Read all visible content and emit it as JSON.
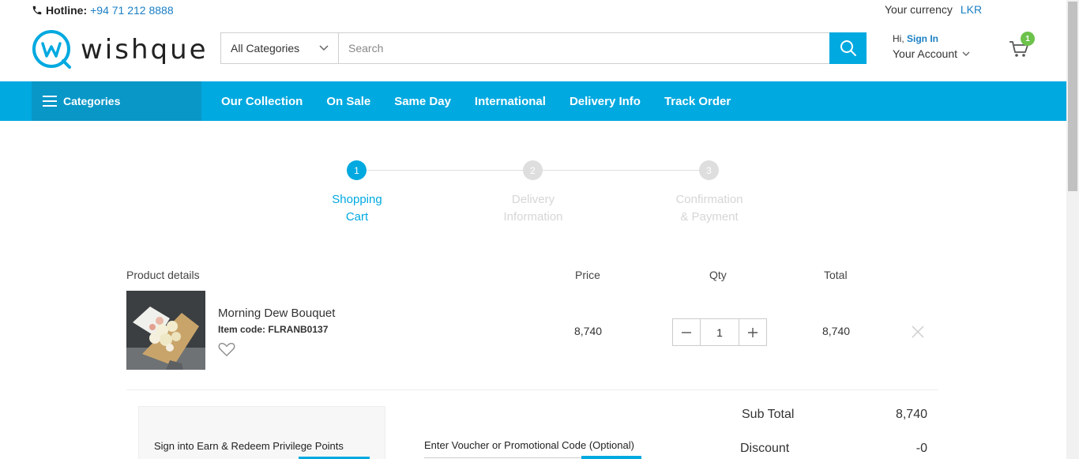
{
  "topbar": {
    "hotline_label": "Hotline:",
    "hotline_number": "+94 71 212 8888",
    "currency_label": "Your currency",
    "currency_code": "LKR"
  },
  "brand": {
    "name": "wishque",
    "color": "#00a9e0"
  },
  "search": {
    "category": "All Categories",
    "placeholder": "Search",
    "icon": "search-icon"
  },
  "account": {
    "greeting": "Hi,",
    "sign_in": "Sign In",
    "your_account": "Your Account",
    "cart_count": "1"
  },
  "nav": {
    "categories_label": "Categories",
    "links": [
      "Our Collection",
      "On Sale",
      "Same Day",
      "International",
      "Delivery Info",
      "Track Order"
    ]
  },
  "steps": [
    {
      "num": "1",
      "line1": "Shopping",
      "line2": "Cart",
      "active": true
    },
    {
      "num": "2",
      "line1": "Delivery",
      "line2": "Information",
      "active": false
    },
    {
      "num": "3",
      "line1": "Confirmation",
      "line2": "& Payment",
      "active": false
    }
  ],
  "cart_table": {
    "headers": {
      "product": "Product details",
      "price": "Price",
      "qty": "Qty",
      "total": "Total"
    },
    "items": [
      {
        "name": "Morning Dew Bouquet",
        "code_label": "Item code:",
        "code": "FLRANB0137",
        "price": "8,740",
        "qty": "1",
        "total": "8,740"
      }
    ]
  },
  "points": {
    "label": "Sign into Earn & Redeem Privilege Points"
  },
  "voucher": {
    "label": "Enter Voucher or Promotional Code (Optional)"
  },
  "summary": {
    "subtotal_label": "Sub Total",
    "subtotal_value": "8,740",
    "discount_label": "Discount",
    "discount_value": "-0"
  },
  "colors": {
    "accent": "#00a9e0",
    "nav_dark": "#0997c8",
    "badge": "#6cc24a",
    "link": "#1a7fc4"
  }
}
